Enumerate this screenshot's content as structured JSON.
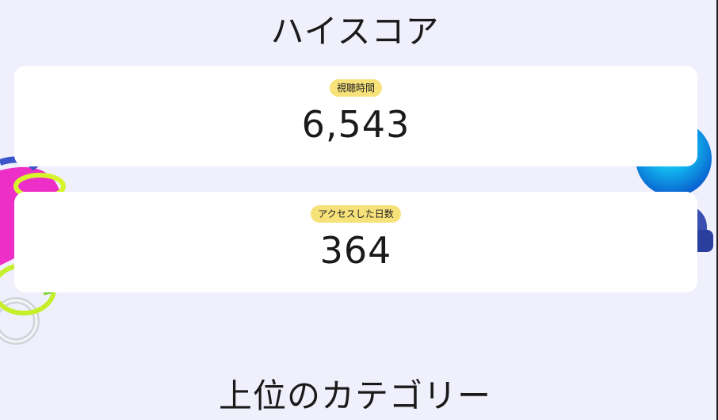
{
  "high_score": {
    "title": "ハイスコア",
    "cards": [
      {
        "label": "視聴時間",
        "value": "6,543"
      },
      {
        "label": "アクセスした日数",
        "value": "364"
      }
    ]
  },
  "top_categories": {
    "title": "上位のカテゴリー"
  },
  "colors": {
    "background": "#f0effc",
    "card": "#ffffff",
    "badge": "#f7e27a",
    "text": "#1a1a1a"
  },
  "decorations": [
    "left-3d-rings-decoration",
    "right-blue-sphere-decoration"
  ]
}
